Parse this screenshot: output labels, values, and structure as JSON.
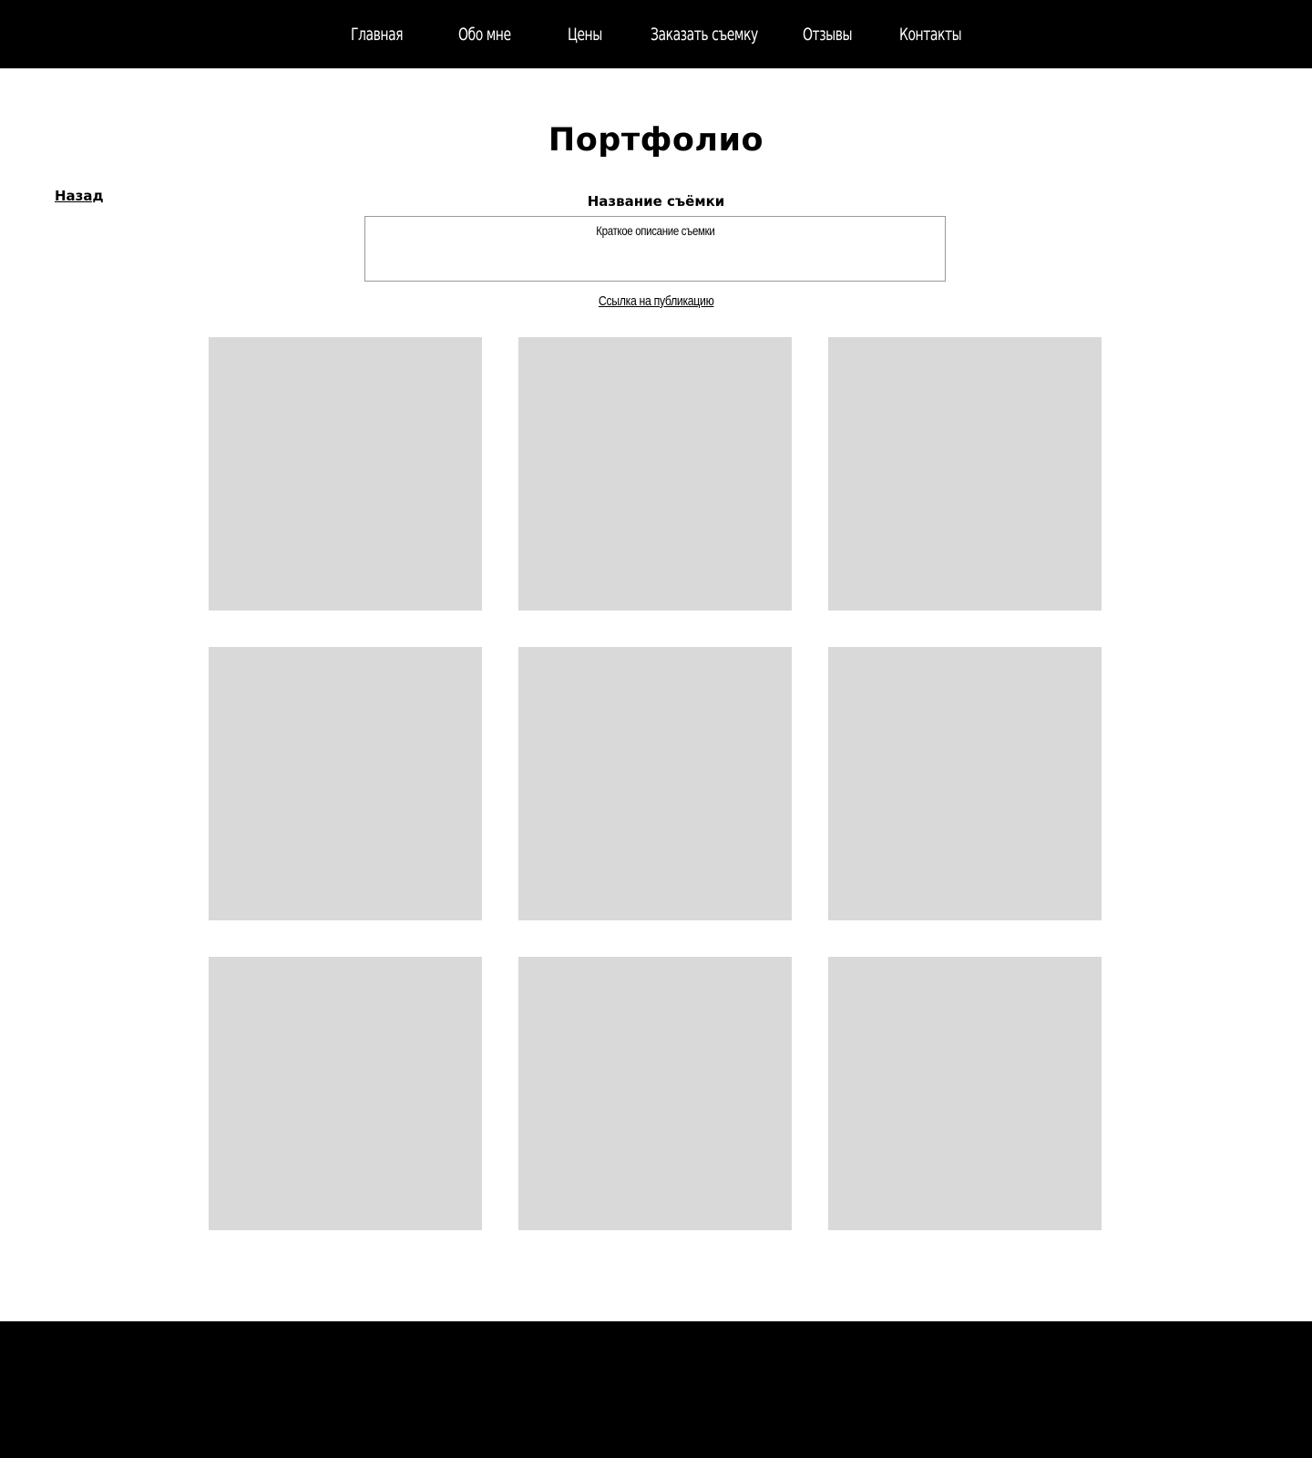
{
  "nav": {
    "items": [
      {
        "label": "Главная"
      },
      {
        "label": "Обо мне"
      },
      {
        "label": "Цены"
      },
      {
        "label": "Заказать съемку"
      },
      {
        "label": "Отзывы"
      },
      {
        "label": "Контакты"
      }
    ]
  },
  "main": {
    "title": "Портфолио",
    "back_label": "Назад",
    "shoot_title": "Название съёмки",
    "description": "Краткое описание съемки",
    "publication_link": "Ссылка на публикацию",
    "photo_count": 9
  },
  "colors": {
    "nav_bg": "#000000",
    "nav_text": "#ffffff",
    "placeholder": "#d9d9d9",
    "footer_bg": "#000000",
    "box_border": "#999999"
  }
}
